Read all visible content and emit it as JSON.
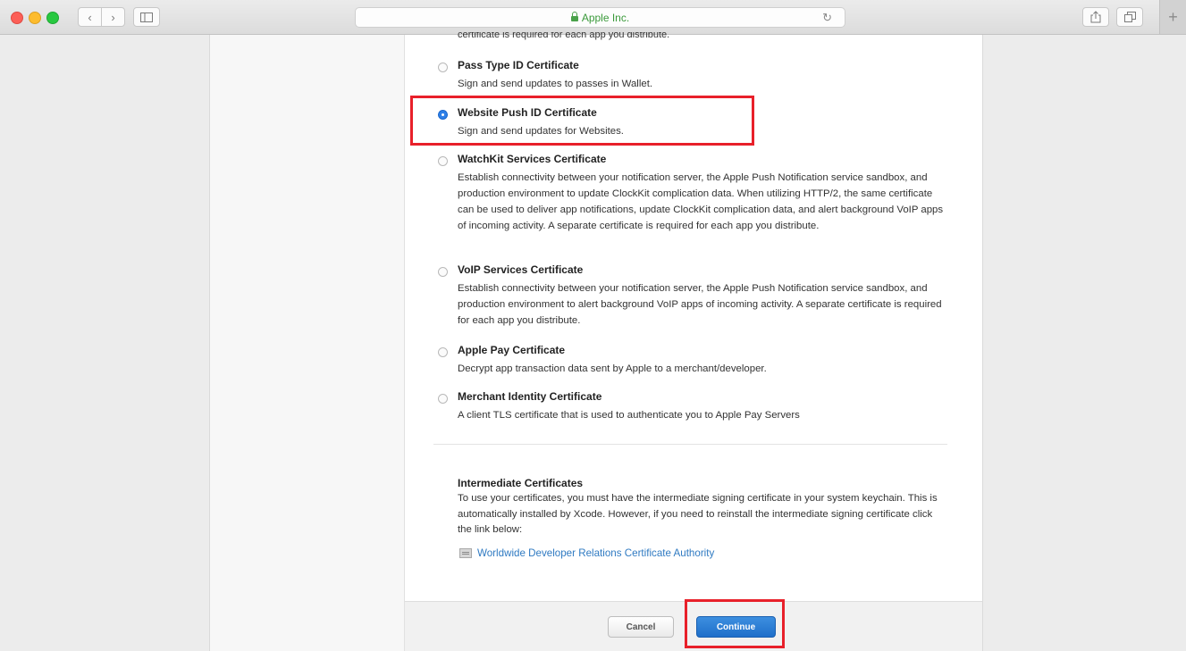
{
  "browser": {
    "url_label": "Apple Inc.",
    "reload_glyph": "↻",
    "back_glyph": "‹",
    "forward_glyph": "›",
    "newtab_glyph": "+",
    "icons": [
      "sidebar-icon",
      "share-icon",
      "tabs-icon",
      "lock-icon",
      "reload-icon"
    ]
  },
  "page": {
    "cut_text": "certificate is required for each app you distribute.",
    "options": [
      {
        "title": "Pass Type ID Certificate",
        "desc": "Sign and send updates to passes in Wallet.",
        "selected": false
      },
      {
        "title": "Website Push ID Certificate",
        "desc": "Sign and send updates for Websites.",
        "selected": true
      },
      {
        "title": "WatchKit Services Certificate",
        "desc": "Establish connectivity between your notification server, the Apple Push Notification service sandbox, and production environment to update ClockKit complication data. When utilizing HTTP/2, the same certificate can be used to deliver app notifications, update ClockKit complication data, and alert background VoIP apps of incoming activity. A separate certificate is required for each app you distribute.",
        "selected": false
      },
      {
        "title": "VoIP Services Certificate",
        "desc": "Establish connectivity between your notification server, the Apple Push Notification service sandbox, and production environment to alert background VoIP apps of incoming activity. A separate certificate is required for each app you distribute.",
        "selected": false
      },
      {
        "title": "Apple Pay Certificate",
        "desc": "Decrypt app transaction data sent by Apple to a merchant/developer.",
        "selected": false
      },
      {
        "title": "Merchant Identity Certificate",
        "desc": "A client TLS certificate that is used to authenticate you to Apple Pay Servers",
        "selected": false
      }
    ],
    "intermediate": {
      "title": "Intermediate Certificates",
      "text": "To use your certificates, you must have the intermediate signing certificate in your system keychain. This is automatically installed by Xcode. However, if you need to reinstall the intermediate signing certificate click the link below:",
      "link": "Worldwide Developer Relations Certificate Authority"
    },
    "buttons": {
      "cancel": "Cancel",
      "continue": "Continue"
    }
  },
  "colors": {
    "accent": "#2d7fe8",
    "highlight": "#e8202a",
    "link": "#2f7ac2"
  }
}
